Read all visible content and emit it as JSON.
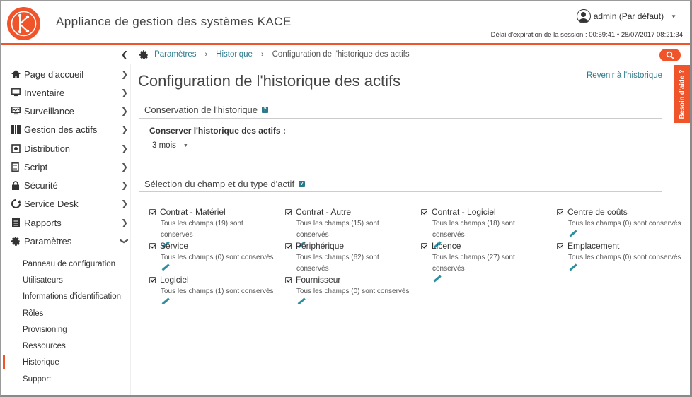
{
  "header": {
    "logo_letter": "K",
    "app_title": "Appliance de gestion des systèmes KACE",
    "user_label": "admin (Par défaut)",
    "session_text": "Délai d'expiration de la session : 00:59:41  •  28/07/2017 08:21:34"
  },
  "breadcrumb": {
    "items": [
      "Paramètres",
      "Historique",
      "Configuration de l'historique des actifs"
    ]
  },
  "help_tab": "Besoin d'aide ?",
  "sidebar": {
    "items": [
      {
        "label": "Page d'accueil",
        "icon": "home-icon"
      },
      {
        "label": "Inventaire",
        "icon": "monitor-icon"
      },
      {
        "label": "Surveillance",
        "icon": "surveillance-icon"
      },
      {
        "label": "Gestion des actifs",
        "icon": "barcode-icon"
      },
      {
        "label": "Distribution",
        "icon": "distribution-icon"
      },
      {
        "label": "Script",
        "icon": "script-icon"
      },
      {
        "label": "Sécurité",
        "icon": "lock-icon"
      },
      {
        "label": "Service Desk",
        "icon": "service-desk-icon"
      },
      {
        "label": "Rapports",
        "icon": "report-icon"
      },
      {
        "label": "Paramètres",
        "icon": "gear-icon"
      }
    ],
    "subitems": [
      "Panneau de configuration",
      "Utilisateurs",
      "Informations d'identification",
      "Rôles",
      "Provisioning",
      "Ressources",
      "Historique",
      "Support"
    ],
    "active_subitem": "Historique"
  },
  "main": {
    "title": "Configuration de l'historique des actifs",
    "back_link": "Revenir à l'historique",
    "retention_section": "Conservation de l'historique",
    "retention_label": "Conserver l'historique des actifs :",
    "retention_value": "3 mois",
    "selection_section": "Sélection du champ et du type d'actif",
    "help_glyph": "?"
  },
  "assets": [
    {
      "name": "Contrat - Matériel",
      "desc": "Tous les champs (19) sont conservés",
      "checked": true
    },
    {
      "name": "Contrat - Autre",
      "desc": "Tous les champs (15) sont conservés",
      "checked": true
    },
    {
      "name": "Contrat - Logiciel",
      "desc": "Tous les champs (18) sont conservés",
      "checked": true
    },
    {
      "name": "Centre de coûts",
      "desc": "Tous les champs (0) sont conservés",
      "checked": true
    },
    {
      "name": "Service",
      "desc": "Tous les champs (0) sont conservés",
      "checked": true
    },
    {
      "name": "Périphérique",
      "desc": "Tous les champs (62) sont conservés",
      "checked": true
    },
    {
      "name": "Licence",
      "desc": "Tous les champs (27) sont conservés",
      "checked": true
    },
    {
      "name": "Emplacement",
      "desc": "Tous les champs (0) sont conservés",
      "checked": true
    },
    {
      "name": "Logiciel",
      "desc": "Tous les champs (1) sont conservés",
      "checked": true
    },
    {
      "name": "Fournisseur",
      "desc": "Tous les champs (0) sont conservés",
      "checked": true
    }
  ],
  "colors": {
    "accent": "#f0542a",
    "link": "#2a7a8c"
  }
}
